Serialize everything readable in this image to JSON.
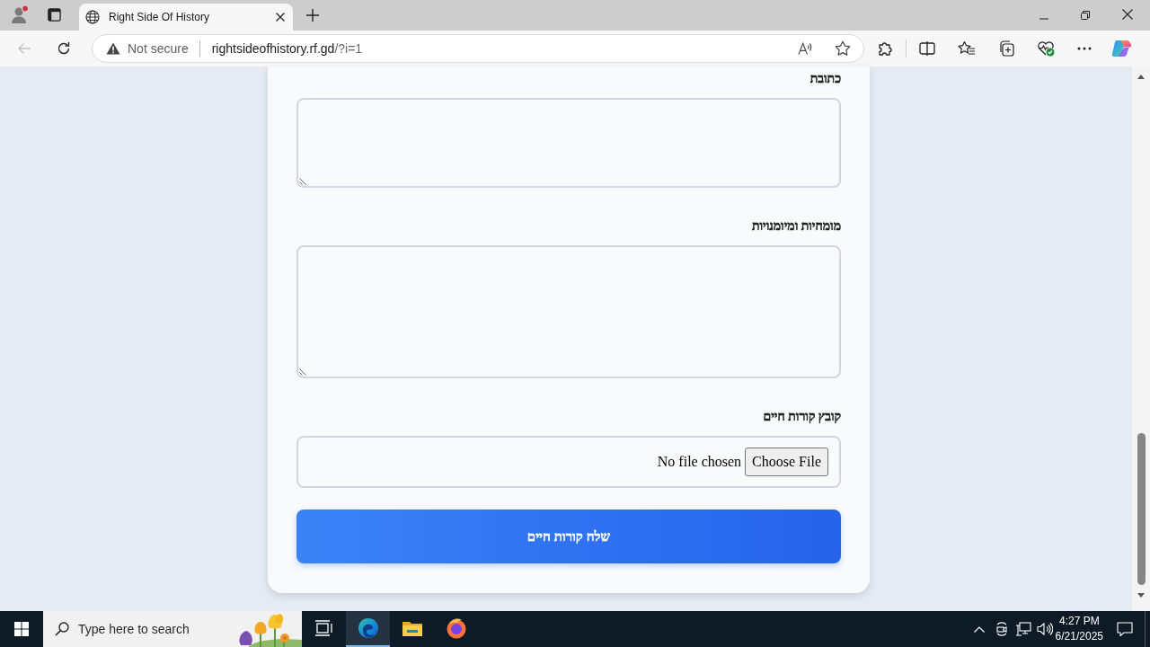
{
  "browser": {
    "tabs": [
      {
        "title": "Right Side Of History",
        "selected": true
      }
    ],
    "nav": {
      "back_disabled": true
    },
    "address": {
      "security": "Not secure",
      "host": "rightsideofhistory.rf.gd",
      "path": "/?i=1"
    }
  },
  "form": {
    "fields": [
      {
        "kind": "textarea",
        "label": "כתובת"
      },
      {
        "kind": "textarea",
        "label": "מומחיות ומיומנויות"
      },
      {
        "kind": "file",
        "label": "קובץ קורות חיים",
        "button": "Choose File",
        "status": "No file chosen"
      }
    ],
    "submit": "שלח קורות חיים"
  },
  "taskbar": {
    "search": {
      "placeholder": "Type here to search"
    },
    "apps": [
      {
        "kind": "taskview",
        "selected": false
      },
      {
        "kind": "browser",
        "selected": true
      },
      {
        "kind": "files",
        "selected": false
      },
      {
        "kind": "firefox",
        "selected": false
      }
    ],
    "clock": {
      "time": "4:27 PM",
      "date": "6/21/2025"
    }
  }
}
